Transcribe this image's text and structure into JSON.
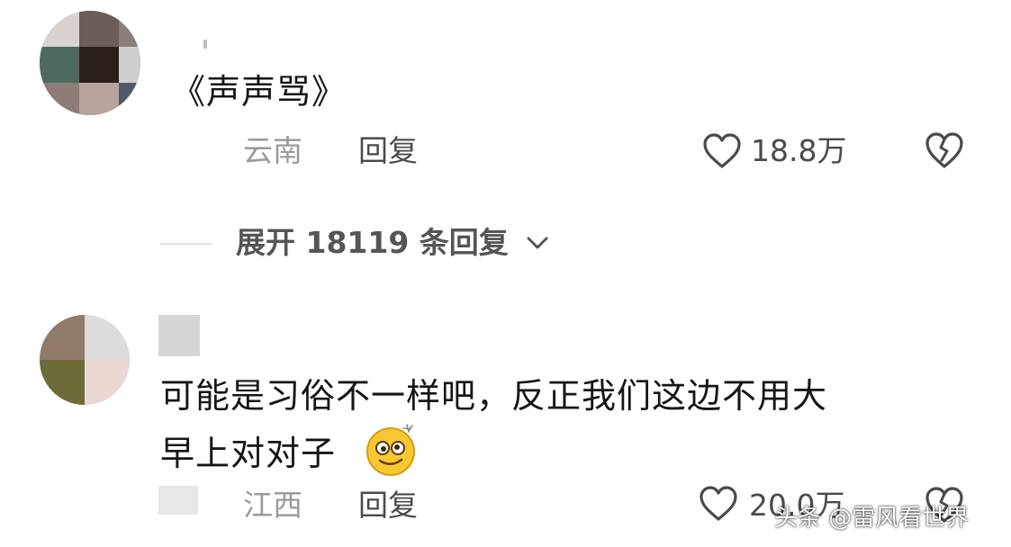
{
  "comments": [
    {
      "text_lines": [
        "《声声骂》"
      ],
      "region": "云南",
      "reply_label": "回复",
      "like_count": "18.8万",
      "like_icon": "heart-outline-icon",
      "dislike_icon": "broken-heart-icon"
    },
    {
      "text_lines": [
        "可能是习俗不一样吧，反正我们这边不用大",
        "早上对对子"
      ],
      "region": "江西",
      "reply_label": "回复",
      "like_count": "20.0万",
      "like_icon": "heart-outline-icon",
      "dislike_icon": "broken-heart-icon",
      "emoji": "dizzy-smile-emoji"
    }
  ],
  "expand_replies": {
    "label": "展开 18119 条回复",
    "icon": "chevron-down-icon"
  },
  "watermark": "头条 @雷风看世界",
  "colors": {
    "text": "#161616",
    "meta_gray": "#9a9a9a",
    "action_gray": "#4a4a4a",
    "divider": "#e2e2e2"
  }
}
